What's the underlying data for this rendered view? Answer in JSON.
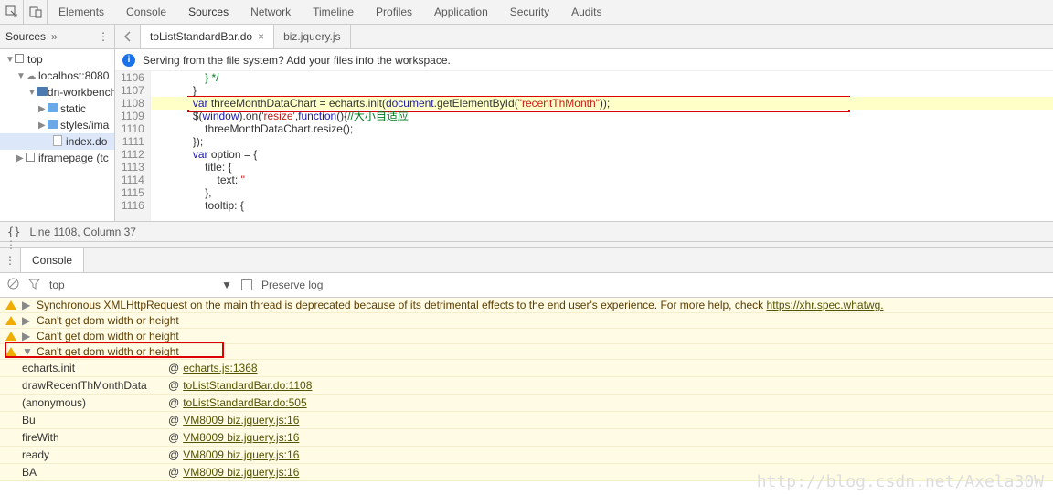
{
  "topbar": {
    "tabs": [
      "Elements",
      "Console",
      "Sources",
      "Network",
      "Timeline",
      "Profiles",
      "Application",
      "Security",
      "Audits"
    ],
    "active_index": 2
  },
  "sidebar_header": {
    "label": "Sources",
    "chevron": "»",
    "menu": "⋮"
  },
  "file_tabs": [
    {
      "name": "toListStandardBar.do",
      "closable": true,
      "active": true
    },
    {
      "name": "biz.jquery.js",
      "closable": false,
      "active": false
    }
  ],
  "infobar": {
    "text": "Serving from the file system? Add your files into the workspace."
  },
  "tree": [
    {
      "depth": 0,
      "arrow": "▼",
      "icon": "frame",
      "label": "top"
    },
    {
      "depth": 1,
      "arrow": "▼",
      "icon": "cloud",
      "label": "localhost:8080"
    },
    {
      "depth": 2,
      "arrow": "▼",
      "icon": "folder-dark",
      "label": "dn-workbench"
    },
    {
      "depth": 3,
      "arrow": "▶",
      "icon": "folder",
      "label": "static"
    },
    {
      "depth": 3,
      "arrow": "▶",
      "icon": "folder",
      "label": "styles/ima"
    },
    {
      "depth": 4,
      "arrow": "",
      "icon": "file",
      "label": "index.do",
      "selected": true
    },
    {
      "depth": 1,
      "arrow": "▶",
      "icon": "frame",
      "label": "iframepage (tc"
    }
  ],
  "gutter": [
    "1106",
    "1107",
    "1108",
    "1109",
    "1110",
    "1111",
    "1112",
    "1113",
    "1114",
    "1115",
    "1116"
  ],
  "code_lines": [
    {
      "frags": [
        {
          "t": "                } */",
          "c": "com"
        }
      ]
    },
    {
      "frags": [
        {
          "t": "            }",
          "c": ""
        }
      ]
    },
    {
      "hl": true,
      "frags": [
        {
          "t": "            ",
          "c": ""
        },
        {
          "t": "var",
          "c": "kw"
        },
        {
          "t": " threeMonthDataChart = echarts.init(",
          "c": ""
        },
        {
          "t": "document",
          "c": "obj"
        },
        {
          "t": ".getElementById(",
          "c": ""
        },
        {
          "t": "\"recentThMonth\"",
          "c": "str"
        },
        {
          "t": "));",
          "c": ""
        }
      ]
    },
    {
      "frags": [
        {
          "t": "            $(",
          "c": ""
        },
        {
          "t": "window",
          "c": "obj"
        },
        {
          "t": ").on(",
          "c": ""
        },
        {
          "t": "'resize'",
          "c": "str"
        },
        {
          "t": ",",
          "c": ""
        },
        {
          "t": "function",
          "c": "kw"
        },
        {
          "t": "(){",
          "c": ""
        },
        {
          "t": "//大小自适应",
          "c": "com"
        }
      ]
    },
    {
      "frags": [
        {
          "t": "                threeMonthDataChart.resize();",
          "c": ""
        }
      ]
    },
    {
      "frags": [
        {
          "t": "            });",
          "c": ""
        }
      ]
    },
    {
      "frags": [
        {
          "t": "            ",
          "c": ""
        },
        {
          "t": "var",
          "c": "kw"
        },
        {
          "t": " option = {",
          "c": ""
        }
      ]
    },
    {
      "frags": [
        {
          "t": "                title: {",
          "c": ""
        }
      ]
    },
    {
      "frags": [
        {
          "t": "                    text: ",
          "c": ""
        },
        {
          "t": "''",
          "c": "str"
        }
      ]
    },
    {
      "frags": [
        {
          "t": "                },",
          "c": ""
        }
      ]
    },
    {
      "frags": [
        {
          "t": "                tooltip: {",
          "c": ""
        }
      ]
    }
  ],
  "status": {
    "braces": "{}",
    "pos": "Line 1108, Column 37"
  },
  "console_drawer": {
    "tab": "Console"
  },
  "console_filter": {
    "context": "top",
    "preserve_label": "Preserve log"
  },
  "console_msgs": [
    {
      "arrow": "▶",
      "text_pre": "Synchronous XMLHttpRequest on the main thread is deprecated because of its detrimental effects to the end user's experience. For more help, check ",
      "link": "https://xhr.spec.whatwg."
    },
    {
      "arrow": "▶",
      "text": "Can't get dom width or height"
    },
    {
      "arrow": "▶",
      "text": "Can't get dom width or height"
    },
    {
      "arrow": "▼",
      "text": "Can't get dom width or height",
      "boxed": true
    }
  ],
  "stack": [
    {
      "fn": "echarts.init",
      "loc": "echarts.js:1368"
    },
    {
      "fn": "drawRecentThMonthData",
      "loc": "toListStandardBar.do:1108"
    },
    {
      "fn": "(anonymous)",
      "loc": "toListStandardBar.do:505"
    },
    {
      "fn": "Bu",
      "loc": "VM8009 biz.jquery.js:16"
    },
    {
      "fn": "fireWith",
      "loc": "VM8009 biz.jquery.js:16"
    },
    {
      "fn": "ready",
      "loc": "VM8009 biz.jquery.js:16"
    },
    {
      "fn": "BA",
      "loc": "VM8009 biz.jquery.js:16"
    }
  ],
  "watermark": "http://blog.csdn.net/Axela30W"
}
